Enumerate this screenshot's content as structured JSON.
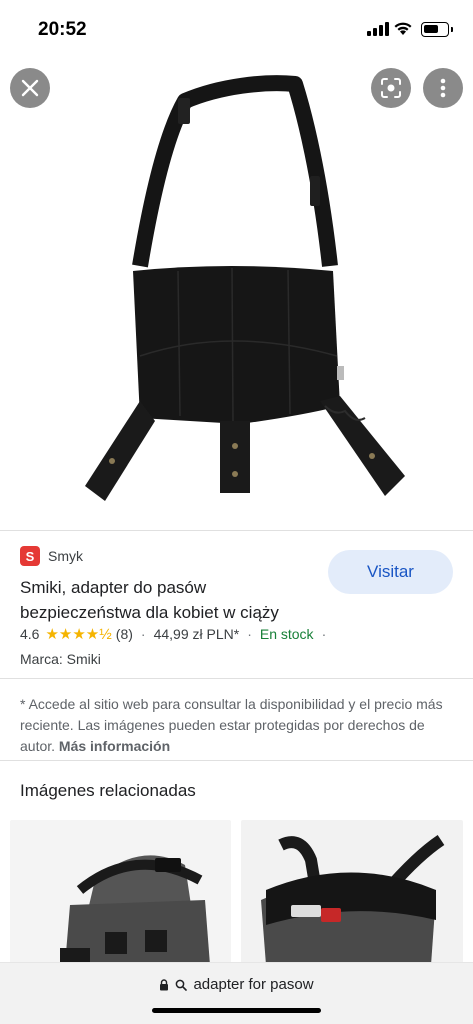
{
  "status": {
    "time": "20:52"
  },
  "source": {
    "favicon_letter": "S",
    "name": "Smyk"
  },
  "product": {
    "title": "Smiki, adapter do pasów bezpieczeństwa dla kobiet w ciąży",
    "rating": "4.6",
    "stars": "★★★★½",
    "review_count": "(8)",
    "price": "44,99 zł PLN*",
    "availability": "En stock",
    "brand": "Marca: Smiki"
  },
  "actions": {
    "visit_label": "Visitar"
  },
  "disclaimer": {
    "text": "* Accede al sitio web para consultar la disponibilidad y el precio más reciente. Las imágenes pueden estar protegidas por derechos de autor.",
    "more_link": "Más información"
  },
  "related": {
    "title": "Imágenes relacionadas"
  },
  "url_bar": {
    "text": "adapter for pasow"
  },
  "icons": [
    "close-icon",
    "lens-icon",
    "more-vert-icon",
    "lock-icon",
    "search-icon",
    "signal-icon",
    "wifi-icon",
    "battery-icon"
  ],
  "colors": {
    "accent": "#1a56c4",
    "visit_bg": "#e3ecfa",
    "in_stock": "#188038",
    "star": "#f5b400"
  }
}
